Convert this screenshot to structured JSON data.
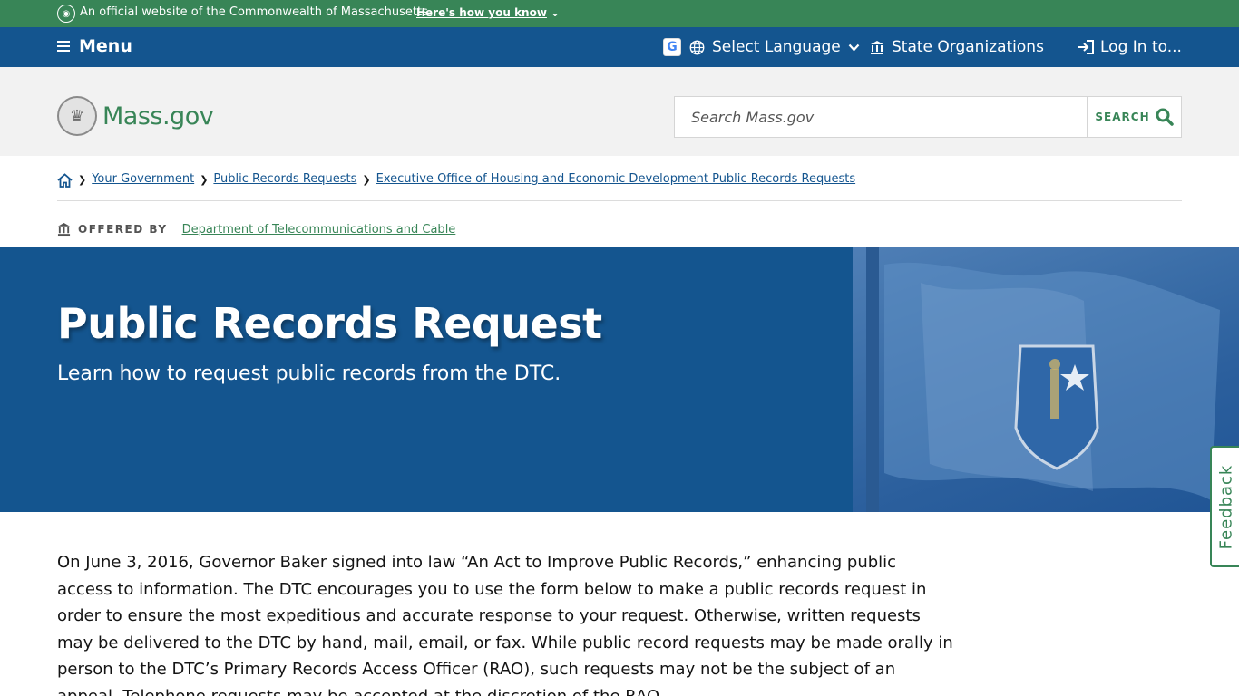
{
  "official_banner": {
    "text": "An official website of the Commonwealth of Massachusetts",
    "how_link": "Here's how you know"
  },
  "utility_nav": {
    "menu_label": "Menu",
    "language_label": "Select Language",
    "state_orgs_label": "State Organizations",
    "login_label": "Log In to..."
  },
  "header": {
    "logo_text": "Mass.gov",
    "search_placeholder": "Search Mass.gov",
    "search_button": "SEARCH"
  },
  "breadcrumb": {
    "items": [
      "Your Government",
      "Public Records Requests",
      "Executive Office of Housing and Economic Development Public Records Requests"
    ]
  },
  "offered_by": {
    "label": "OFFERED BY",
    "org": "Department of Telecommunications and Cable"
  },
  "hero": {
    "title": "Public Records Request",
    "subtitle": "Learn how to request public records from the DTC."
  },
  "content": {
    "paragraph": "On June 3, 2016, Governor Baker signed into law “An Act to Improve Public Records,” enhancing public access to information. The DTC encourages you to use the form below to make a public records request in order to ensure the most expeditious and accurate response to your request. Otherwise, written requests may be delivered to the DTC by hand, mail, email, or fax. While public record requests may be made orally in person to the DTC’s Primary Records Access Officer (RAO), such requests may not be the subject of an appeal. Telephone requests may be accepted at the discretion of the RAO."
  },
  "feedback": {
    "label": "Feedback"
  },
  "colors": {
    "green": "#388557",
    "blue": "#14558f",
    "header_bg": "#f2f2f2"
  }
}
